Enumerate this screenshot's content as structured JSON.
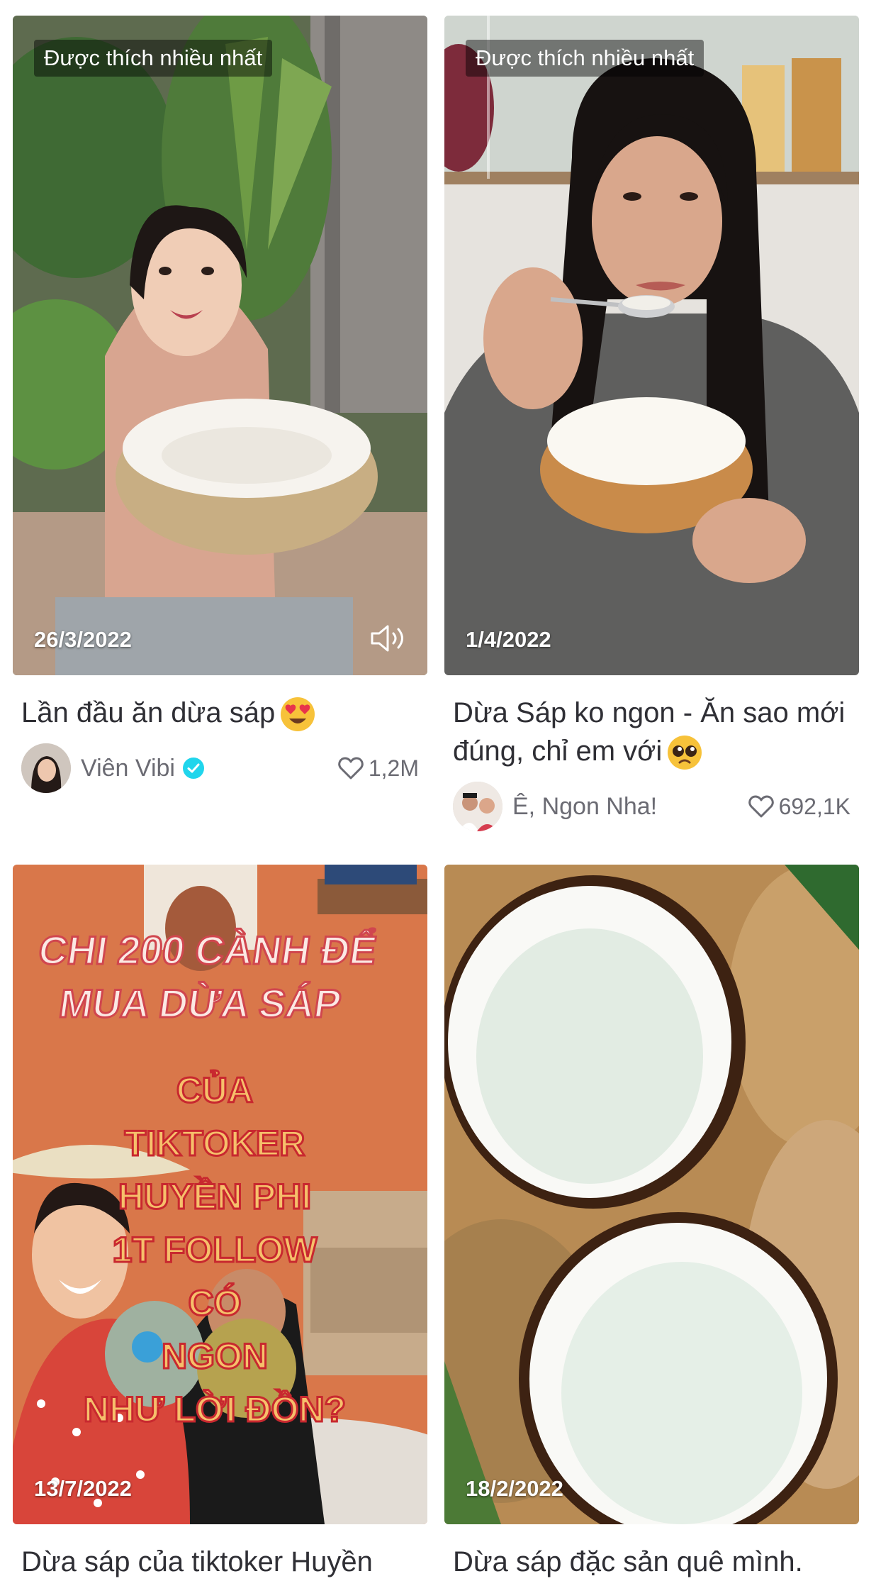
{
  "videos": [
    {
      "badge": "Được thích nhiều nhất",
      "date": "26/3/2022",
      "caption": "Lần đầu ăn dừa sáp",
      "caption_emoji": "heart-eyes",
      "author": "Viên Vibi",
      "verified": true,
      "likes": "1,2M",
      "show_sound_icon": true
    },
    {
      "badge": "Được thích nhiều nhất",
      "date": "1/4/2022",
      "caption": "Dừa Sáp ko ngon - Ăn sao mới đúng, chỉ em với",
      "caption_emoji": "pleading-face",
      "author": "Ê, Ngon Nha!",
      "verified": false,
      "likes": "692,1K",
      "show_sound_icon": false
    },
    {
      "date": "13/7/2022",
      "caption": "Dừa sáp của tiktoker Huyền",
      "overlay_text_top": "CHI 200 CÀNH ĐỂ MUA DỪA SÁP",
      "overlay_text_bottom": "CỦA TIKTOKER HUYỀN PHI 1T FOLLOW CÓ NGON NHƯ LỜI ĐỒN?"
    },
    {
      "date": "18/2/2022",
      "caption": "Dừa sáp đặc sản quê mình."
    }
  ],
  "colors": {
    "verified": "#20d5ec",
    "text": "#2f2f35",
    "meta": "#6b6b73"
  }
}
